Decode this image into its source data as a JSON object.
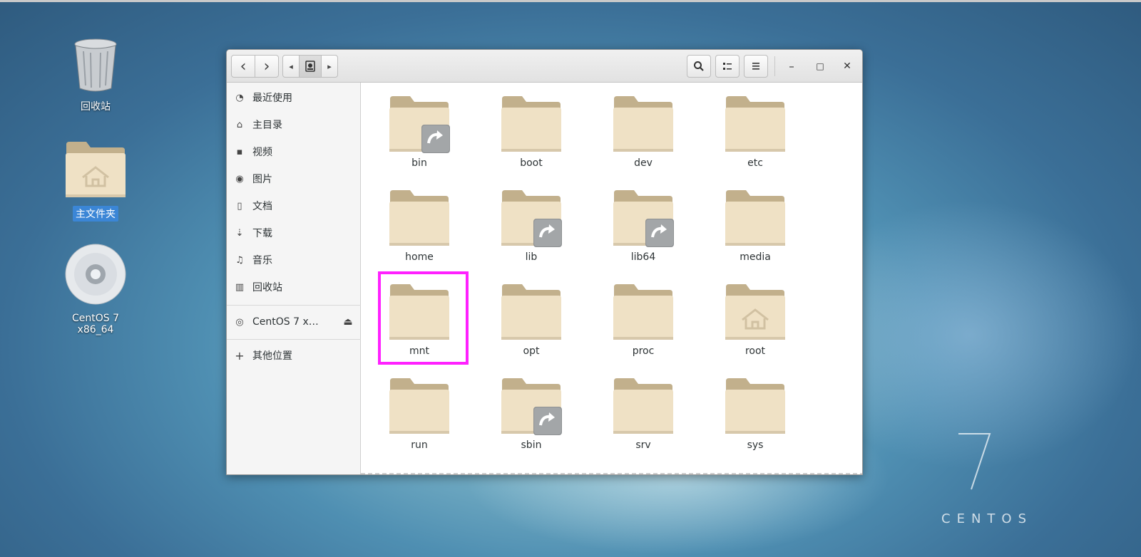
{
  "desktop": {
    "icons": [
      {
        "label": "回收站",
        "icon": "trash-icon"
      },
      {
        "label": "主文件夹",
        "icon": "home-folder-icon"
      },
      {
        "label": "CentOS 7 x86_64",
        "icon": "disc-icon"
      }
    ],
    "brand": {
      "number": "7",
      "text": "CENTOS"
    }
  },
  "window": {
    "toolbar": {
      "back": "‹",
      "forward": "›",
      "path_left": "◂",
      "path_right": "▸",
      "search_icon": "search-icon",
      "view_icon": "list-view-icon",
      "menu_icon": "menu-icon",
      "minimize": "–",
      "maximize": "□",
      "close": "✕"
    },
    "sidebar": {
      "items": [
        {
          "label": "最近使用",
          "icon": "◔"
        },
        {
          "label": "主目录",
          "icon": "⌂"
        },
        {
          "label": "视频",
          "icon": "▪"
        },
        {
          "label": "图片",
          "icon": "◉"
        },
        {
          "label": "文档",
          "icon": "▯"
        },
        {
          "label": "下载",
          "icon": "⇣"
        },
        {
          "label": "音乐",
          "icon": "♫"
        },
        {
          "label": "回收站",
          "icon": "▥"
        }
      ],
      "device": {
        "label": "CentOS 7 x…",
        "eject": "⏏",
        "icon": "◎"
      },
      "other": {
        "label": "其他位置",
        "icon": "+"
      }
    },
    "files": [
      {
        "name": "bin",
        "link": true,
        "home": false
      },
      {
        "name": "boot",
        "link": false,
        "home": false
      },
      {
        "name": "dev",
        "link": false,
        "home": false
      },
      {
        "name": "etc",
        "link": false,
        "home": false
      },
      {
        "name": "home",
        "link": false,
        "home": false
      },
      {
        "name": "lib",
        "link": true,
        "home": false
      },
      {
        "name": "lib64",
        "link": true,
        "home": false
      },
      {
        "name": "media",
        "link": false,
        "home": false
      },
      {
        "name": "mnt",
        "link": false,
        "home": false
      },
      {
        "name": "opt",
        "link": false,
        "home": false
      },
      {
        "name": "proc",
        "link": false,
        "home": false
      },
      {
        "name": "root",
        "link": false,
        "home": true
      },
      {
        "name": "run",
        "link": false,
        "home": false
      },
      {
        "name": "sbin",
        "link": true,
        "home": false
      },
      {
        "name": "srv",
        "link": false,
        "home": false
      },
      {
        "name": "sys",
        "link": false,
        "home": false
      }
    ],
    "highlighted": "mnt"
  },
  "colors": {
    "folder_back": "#c2b08c",
    "folder_front": "#efe1c5",
    "highlight": "#ff21ff",
    "selection": "#3b86d6"
  }
}
